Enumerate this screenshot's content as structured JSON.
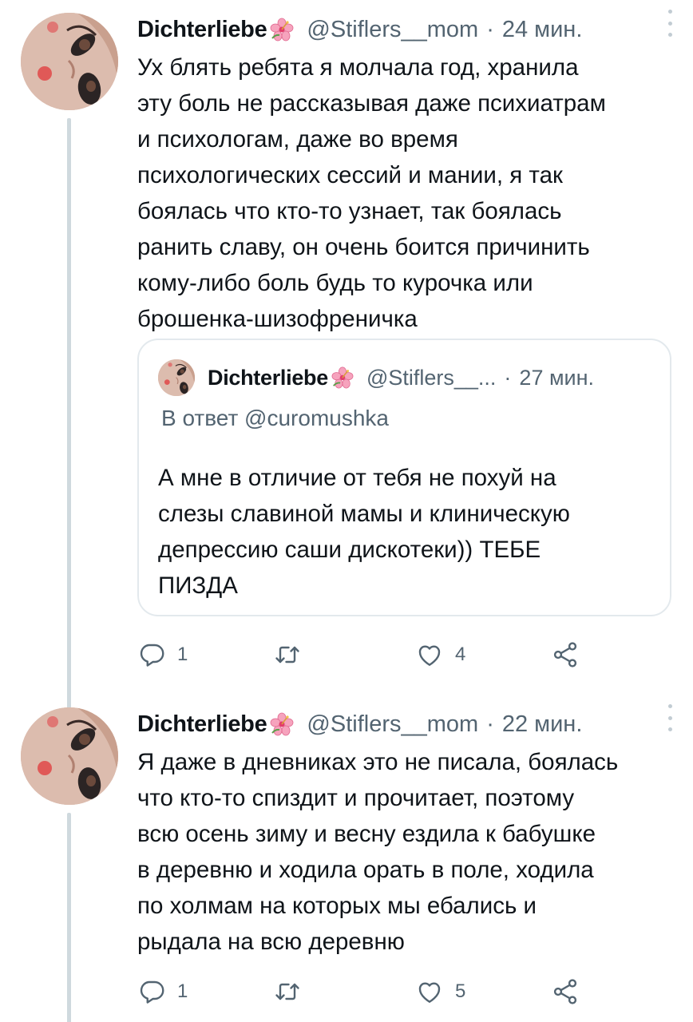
{
  "tweets": [
    {
      "author": "Dichterliebe",
      "handle": "@Stiflers__mom",
      "separator": "·",
      "time": "24 мин.",
      "text": "Ух блять ребята я молчала год, хранила\nэту боль не рассказывая даже психиатрам\nи психологам, даже во время\nпсихологических сессий и мании, я так\nбоялась что кто-то узнает, так боялась\nранить славу, он очень боится причинить\nкому-либо боль будь то курочка или\nброшенка-шизофреничка",
      "quote": {
        "author": "Dichterliebe",
        "handle": "@Stiflers__...",
        "separator": "·",
        "time": "27 мин.",
        "reply_prefix": "В ответ",
        "reply_to": "@curomushka",
        "text": "А мне в отличие от тебя не похуй на\nслезы славиной мамы и клиническую\nдепрессию саши дискотеки)) ТЕБЕ\nПИЗДА"
      },
      "replies": "1",
      "retweets": "",
      "likes": "4"
    },
    {
      "author": "Dichterliebe",
      "handle": "@Stiflers__mom",
      "separator": "·",
      "time": "22 мин.",
      "text": "Я даже в дневниках это не писала, боялась\nчто кто-то спиздит и прочитает, поэтому\nвсю осень зиму и весну ездила к бабушке\nв деревню и ходила орать в поле, ходила\nпо холмам на которых мы ебались и\nрыдала на всю деревню",
      "replies": "1",
      "retweets": "",
      "likes": "5"
    }
  ],
  "colors": {
    "text": "#0f1419",
    "secondary": "#536471",
    "border": "#e3e9ed",
    "thread_line": "#cfd9de",
    "flower_emoji": "#f06a9a"
  },
  "icons": {
    "reply": "speech-bubble-icon",
    "retweet": "retweet-arrows-icon",
    "like": "heart-outline-icon",
    "share": "share-nodes-icon",
    "more": "vertical-dots-icon",
    "name_emoji": "hibiscus-flower-emoji"
  }
}
